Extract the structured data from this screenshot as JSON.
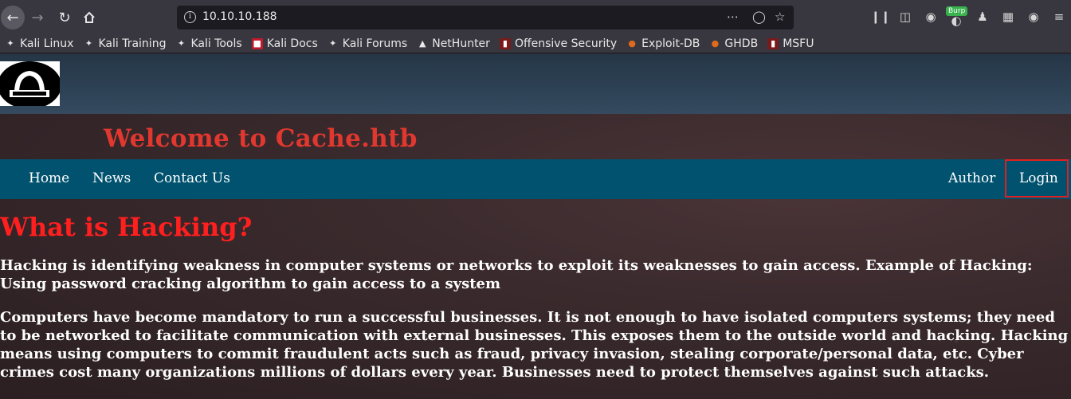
{
  "browser": {
    "url": "10.10.10.188",
    "burp_badge": "Burp",
    "bookmarks": [
      {
        "label": "Kali Linux",
        "icon": "kali-dragon-icon"
      },
      {
        "label": "Kali Training",
        "icon": "kali-dragon-icon"
      },
      {
        "label": "Kali Tools",
        "icon": "kali-dragon-icon"
      },
      {
        "label": "Kali Docs",
        "icon": "kali-docs-icon"
      },
      {
        "label": "Kali Forums",
        "icon": "kali-dragon-icon"
      },
      {
        "label": "NetHunter",
        "icon": "nethunter-icon"
      },
      {
        "label": "Offensive Security",
        "icon": "offsec-icon"
      },
      {
        "label": "Exploit-DB",
        "icon": "exploitdb-icon"
      },
      {
        "label": "GHDB",
        "icon": "exploitdb-icon"
      },
      {
        "label": "MSFU",
        "icon": "offsec-icon"
      }
    ]
  },
  "site": {
    "title": "Welcome to Cache.htb",
    "nav_left": [
      "Home",
      "News",
      "Contact Us"
    ],
    "nav_right": [
      "Author",
      "Login"
    ]
  },
  "content": {
    "heading": "What is Hacking?",
    "para1": "Hacking is identifying weakness in computer systems or networks to exploit its weaknesses to gain access. Example of Hacking: Using password cracking algorithm to gain access to a system",
    "para2": "Computers have become mandatory to run a successful businesses. It is not enough to have isolated computers systems; they need to be networked to facilitate communication with external businesses. This exposes them to the outside world and hacking. Hacking means using computers to commit fraudulent acts such as fraud, privacy invasion, stealing corporate/personal data, etc. Cyber crimes cost many organizations millions of dollars every year. Businesses need to protect themselves against such attacks."
  },
  "colors": {
    "navbar": "#01526f",
    "title_red": "#e0382f",
    "heading_red": "#ff1f1f",
    "login_highlight": "#e02020"
  }
}
